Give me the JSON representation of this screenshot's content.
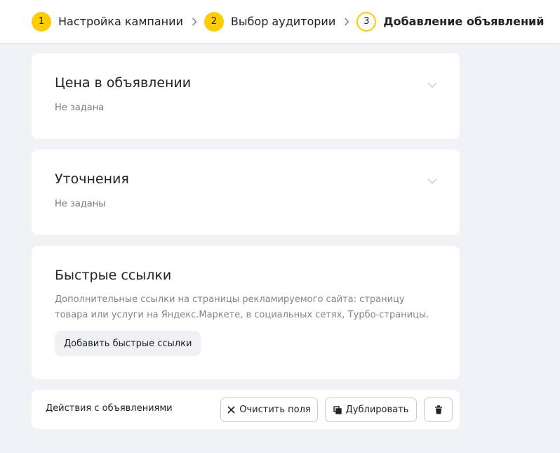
{
  "steps": [
    {
      "number": "1",
      "label": "Настройка кампании"
    },
    {
      "number": "2",
      "label": "Выбор аудитории"
    },
    {
      "number": "3",
      "label": "Добавление объявлений"
    }
  ],
  "price_card": {
    "title": "Цена в объявлении",
    "subtitle": "Не задана"
  },
  "clarifications_card": {
    "title": "Уточнения",
    "subtitle": "Не заданы"
  },
  "quick_links_card": {
    "title": "Быстрые ссылки",
    "description": "Дополнительные ссылки на страницы рекламируемого сайта: страницу товара или услуги на Яндекс.Маркете, в социальных сетях, Турбо-страницы.",
    "add_button_label": "Добавить быстрые ссылки"
  },
  "ad_actions": {
    "label": "Действия с объявлениями",
    "clear_label": "Очистить поля",
    "duplicate_label": "Дублировать"
  },
  "icons": {
    "step_separator": "chevron-right-icon",
    "collapse": "chevron-down-icon",
    "clear": "close-icon",
    "duplicate": "copy-icon",
    "delete": "trash-icon"
  },
  "colors": {
    "accent": "#ffcc00",
    "background": "#f0f2f5",
    "card": "#ffffff",
    "muted_text": "#777777"
  }
}
